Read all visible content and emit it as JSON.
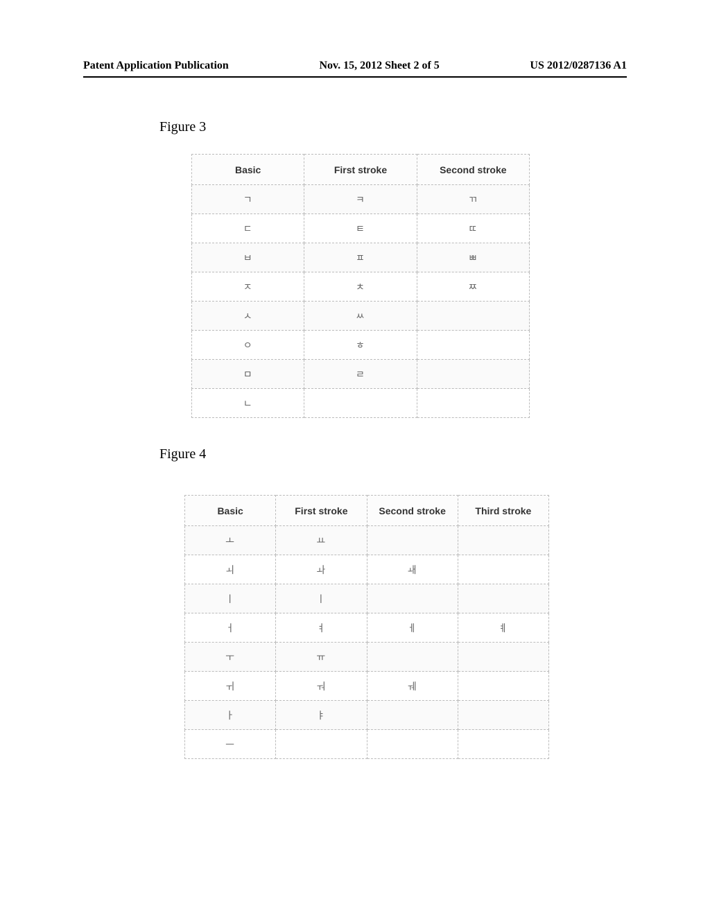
{
  "header": {
    "left": "Patent Application Publication",
    "center": "Nov. 15, 2012  Sheet 2 of 5",
    "right": "US 2012/0287136 A1"
  },
  "figure3": {
    "label": "Figure 3",
    "headers": [
      "Basic",
      "First stroke",
      "Second stroke"
    ],
    "rows": [
      {
        "basic": "ㄱ",
        "first": "ㅋ",
        "second": "ㄲ"
      },
      {
        "basic": "ㄷ",
        "first": "ㅌ",
        "second": "ㄸ"
      },
      {
        "basic": "ㅂ",
        "first": "ㅍ",
        "second": "ㅃ"
      },
      {
        "basic": "ㅈ",
        "first": "ㅊ",
        "second": "ㅉ"
      },
      {
        "basic": "ㅅ",
        "first": "ㅆ",
        "second": ""
      },
      {
        "basic": "ㅇ",
        "first": "ㅎ",
        "second": ""
      },
      {
        "basic": "ㅁ",
        "first": "ㄹ",
        "second": ""
      },
      {
        "basic": "ㄴ",
        "first": "",
        "second": ""
      }
    ]
  },
  "figure4": {
    "label": "Figure 4",
    "headers": [
      "Basic",
      "First stroke",
      "Second stroke",
      "Third stroke"
    ],
    "rows": [
      {
        "basic": "ㅗ",
        "first": "ㅛ",
        "second": "",
        "third": ""
      },
      {
        "basic": "ㅚ",
        "first": "ㅘ",
        "second": "ㅙ",
        "third": ""
      },
      {
        "basic": "ㅣ",
        "first": "ㅣ",
        "second": "",
        "third": ""
      },
      {
        "basic": "ㅓ",
        "first": "ㅕ",
        "second": "ㅔ",
        "third": "ㅖ"
      },
      {
        "basic": "ㅜ",
        "first": "ㅠ",
        "second": "",
        "third": ""
      },
      {
        "basic": "ㅟ",
        "first": "ㅝ",
        "second": "ㅞ",
        "third": ""
      },
      {
        "basic": "ㅏ",
        "first": "ㅑ",
        "second": "",
        "third": ""
      },
      {
        "basic": "ㅡ",
        "first": "",
        "second": "",
        "third": ""
      }
    ]
  }
}
